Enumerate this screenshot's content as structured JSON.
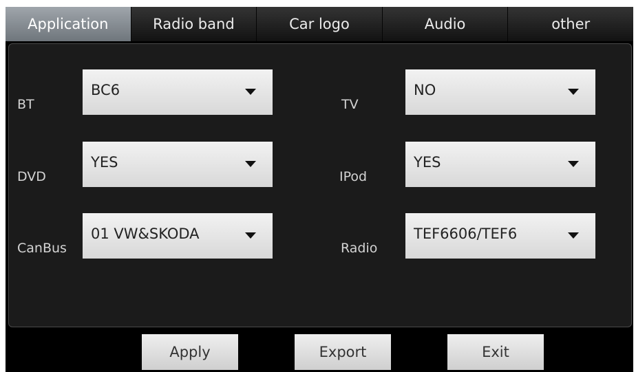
{
  "tabs": [
    {
      "label": "Application",
      "active": true
    },
    {
      "label": "Radio band"
    },
    {
      "label": "Car logo"
    },
    {
      "label": "Audio"
    },
    {
      "label": "other"
    }
  ],
  "settings": {
    "bt": {
      "label": "BT",
      "value": "BC6"
    },
    "tv": {
      "label": "TV",
      "value": "NO"
    },
    "dvd": {
      "label": "DVD",
      "value": "YES"
    },
    "ipod": {
      "label": "IPod",
      "value": "YES"
    },
    "canbus": {
      "label": "CanBus",
      "value": "01 VW&SKODA"
    },
    "radio": {
      "label": "Radio",
      "value": "TEF6606/TEF6"
    }
  },
  "actions": {
    "apply": "Apply",
    "export": "Export",
    "exit": "Exit"
  },
  "colors": {
    "background": "#000000",
    "panel": "#1b1b1b",
    "active_tab": "#8a9096",
    "control": "#e6e6e6"
  }
}
